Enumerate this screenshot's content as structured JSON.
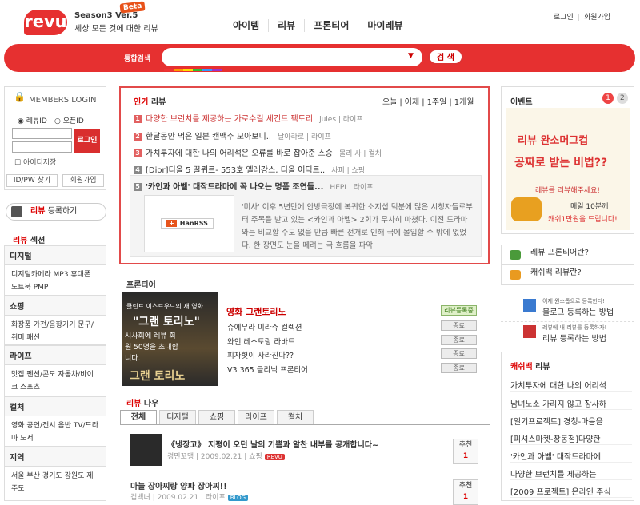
{
  "header": {
    "logo": "revu",
    "version": "Season3 Ver.5",
    "beta": "Beta",
    "tagline": "세상 모든 것에 대한 리뷰",
    "nav": [
      "아이템",
      "리뷰",
      "프론티어",
      "마이레뷰"
    ],
    "login": "로그인",
    "join": "회원가입"
  },
  "search": {
    "label": "통합검색",
    "value": "",
    "button": "검 색"
  },
  "left": {
    "members_login": "MEMBERS LOGIN",
    "radio_revu": "레뷰ID",
    "radio_open": "오픈ID",
    "login_button": "로그인",
    "save_id": "아이디저장",
    "find_idpw": "ID/PW 찾기",
    "join": "회원가입",
    "register_review": "리뷰 등록하기",
    "register_review_red": "리뷰",
    "section_title": "섹션",
    "section_red": "리뷰",
    "categories": [
      {
        "title": "디지털",
        "items": "디지털카메라  MP3  휴대폰  노트북  PMP"
      },
      {
        "title": "쇼핑",
        "items": "화장품  가전/음향기기  문구/취미  패션"
      },
      {
        "title": "라이프",
        "items": "맛집  펜션/콘도  자동차/바이크  스포츠"
      },
      {
        "title": "컬처",
        "items": "영화  공연/전시  음반  TV/드라마  도서"
      },
      {
        "title": "지역",
        "items": "서울  부산  경기도  강원도  제주도"
      }
    ]
  },
  "hot": {
    "title": "인기 리뷰",
    "title_red": "인기",
    "periods": [
      "오늘",
      "어제",
      "1주일",
      "1개월"
    ],
    "items": [
      {
        "n": "1",
        "title": "다양한 브런치를 제공하는 가로수길 세컨드 팩토리",
        "author": "jules | 라이프"
      },
      {
        "n": "2",
        "title": "한달동안 먹은 일본 캔맥주 모아보니..",
        "author": "날아라로 | 라이프"
      },
      {
        "n": "3",
        "title": "가치투자에 대한 나의 어리석은 오류를 바로 잡아준 스승",
        "author": "몰리 사 | 컬처"
      },
      {
        "n": "4",
        "title": "[Dior]디올 5 꿀퀴르- 553호 엘레강스, 디올 어딕트..",
        "author": "사피 | 쇼핑"
      },
      {
        "n": "5",
        "title": "'카인과 아벨' 대작드라마에 꼭 나오는 명품 조연들...",
        "author": "HEPI | 라이프"
      }
    ],
    "hanrss": "HanRSS",
    "description": "'미사' 이후 5년만에 안방극장에 복귀한 소지섭 덕분에 많은 시청자들로부터 주목을 받고 있는 <카인과 아벨> 2회가 무사히 마쳤다. 이전 드라마와는 비교할 수도 없을 만큼 빠른 전개로 인해 극에 몰입할 수 밖에 없었다. 한 장면도 눈을 떼려는 극 흐름을 파악"
  },
  "frontier": {
    "title": "프론티어",
    "banner_top": "클린트 이스트우드의 새 영화",
    "banner_title": "\"그랜 토리노\"",
    "banner_sub": "시사회에 레뷰 회원 50명을 초대합니다.",
    "banner_bottom": "그랜 토리노",
    "items": [
      {
        "title": "영화 그랜토리노",
        "badge": "리뷰등록중",
        "on": true
      },
      {
        "title": "슈에무라 미라쥬 컬렉션",
        "badge": "종료",
        "on": false
      },
      {
        "title": "와인 레스토랑 라바트",
        "badge": "종료",
        "on": false
      },
      {
        "title": "피자헛이 사라진다??",
        "badge": "종료",
        "on": false
      },
      {
        "title": "V3 365 클리닉 프론티어",
        "badge": "종료",
        "on": false
      }
    ]
  },
  "reviews": {
    "title": "리뷰 나우",
    "title_red": "리뷰",
    "tabs": [
      "전체",
      "디지털",
      "쇼핑",
      "라이프",
      "컬처"
    ],
    "items": [
      {
        "title": "《냉장고》 지평이 오던 날의 기쁨과 알찬 내부를 공개합니다~",
        "meta": "경민꼬맹 | 2009.02.21 | 쇼핑",
        "badge": "REVU",
        "rec": "추천",
        "count": "1"
      },
      {
        "title": "마늘 장아찌랑 양파 장아찌!!",
        "meta": "컵벡녀 | 2009.02.21 | 라이프",
        "badge": "BLOG",
        "rec": "추천",
        "count": "1"
      }
    ]
  },
  "right": {
    "event_title": "이벤트",
    "pages": [
      "1",
      "2"
    ],
    "event_line1": "리뷰 완소머그컵",
    "event_line2": "공짜로 받는 비법??",
    "event_line3": "레뷰를 리뷰해주세요!",
    "event_line4": "매일 10분께",
    "event_line5": "캐쉬1만원을 드립니다!",
    "link1": "레뷰 프론티어란?",
    "link2": "캐쉬백 리뷰란?",
    "how1_small": "이제 원스톱으로 등록한다!",
    "how1_big": "블로그 등록하는 방법",
    "how2_small": "레뷰에 내 리뷰를 등록하자!",
    "how2_big": "리뷰 등록하는 방법",
    "cashback_title": "캐쉬백 리뷰",
    "cashback_red": "캐쉬백",
    "cashback_items": [
      "가치투자에 대한 나의 어리석",
      "남녀노소 가리지 않고 장사하",
      "[일기프로젝트] 경청-마음을",
      "[피셔스마켓-창동점]다양한",
      "'카인과 아벨' 대작드라마에",
      "다양한 브런치를 제공하는",
      "[2009 프로젝트] 온라인 주식"
    ]
  }
}
